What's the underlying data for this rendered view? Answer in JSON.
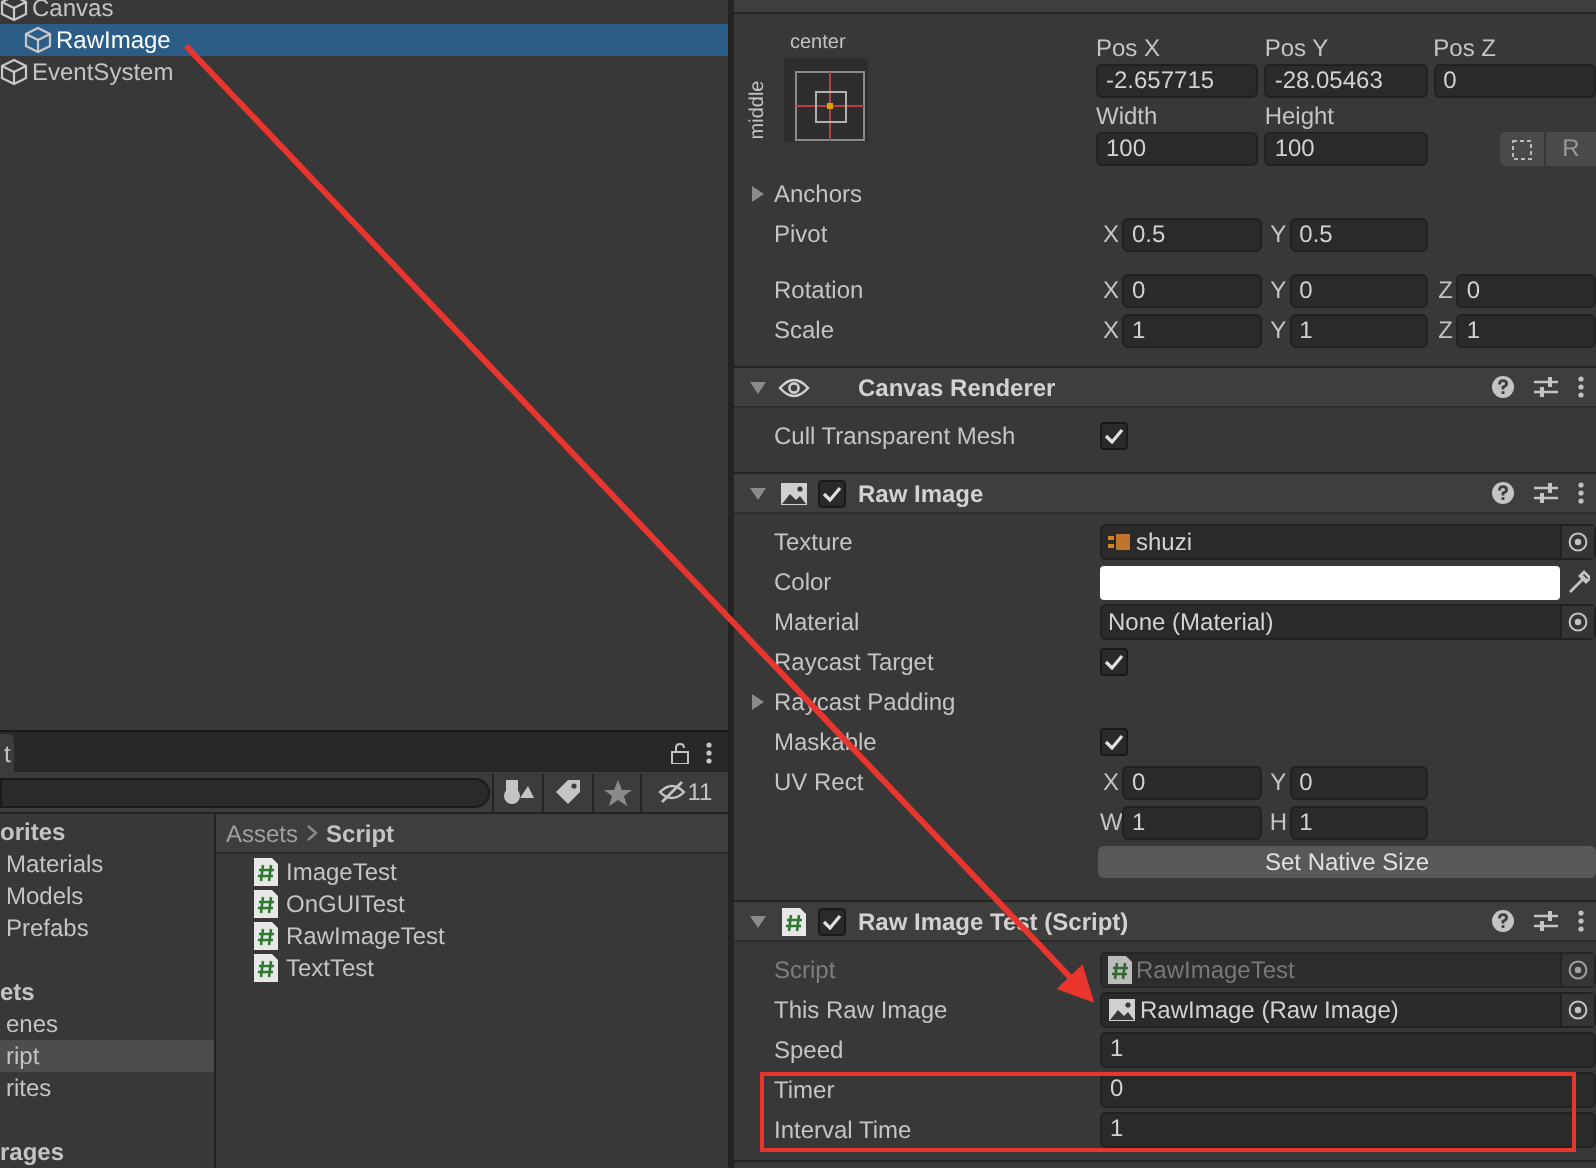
{
  "hierarchy": {
    "items": [
      {
        "label": "Canvas",
        "selected": false,
        "children": [
          {
            "label": "RawImage",
            "selected": true
          }
        ]
      },
      {
        "label": "EventSystem",
        "selected": false
      }
    ]
  },
  "project": {
    "tab": "t",
    "hidden_count": "11",
    "folders": [
      {
        "label": "orites",
        "children": [
          {
            "label": "Materials",
            "selected": false
          },
          {
            "label": "Models",
            "selected": false
          },
          {
            "label": "Prefabs",
            "selected": false
          }
        ]
      },
      {
        "label": "ets",
        "children": [
          {
            "label": "enes",
            "selected": false
          },
          {
            "label": "ript",
            "selected": true
          },
          {
            "label": "rites",
            "selected": false
          }
        ]
      },
      {
        "label": "rages"
      }
    ],
    "breadcrumb": [
      "Assets",
      "Script"
    ],
    "files": [
      "ImageTest",
      "OnGUITest",
      "RawImageTest",
      "TextTest"
    ]
  },
  "inspector": {
    "rect_transform": {
      "anchor_horizontal": "center",
      "anchor_vertical": "middle",
      "position": [
        {
          "label": "Pos X",
          "value": "-2.657715"
        },
        {
          "label": "Pos Y",
          "value": "-28.05463"
        },
        {
          "label": "Pos Z",
          "value": "0"
        }
      ],
      "size": [
        {
          "label": "Width",
          "value": "100"
        },
        {
          "label": "Height",
          "value": "100"
        }
      ],
      "raw_edit_button": "R",
      "rows": [
        {
          "kind": "foldout",
          "label": "Anchors"
        },
        {
          "kind": "vector",
          "label": "Pivot",
          "fields": [
            {
              "axis": "X",
              "value": "0.5"
            },
            {
              "axis": "Y",
              "value": "0.5"
            }
          ]
        },
        {
          "kind": "vector",
          "label": "Rotation",
          "fields": [
            {
              "axis": "X",
              "value": "0"
            },
            {
              "axis": "Y",
              "value": "0"
            },
            {
              "axis": "Z",
              "value": "0"
            }
          ]
        },
        {
          "kind": "vector",
          "label": "Scale",
          "fields": [
            {
              "axis": "X",
              "value": "1"
            },
            {
              "axis": "Y",
              "value": "1"
            },
            {
              "axis": "Z",
              "value": "1"
            }
          ]
        }
      ]
    },
    "components": [
      {
        "title": "Canvas Renderer",
        "kind": "eye",
        "expanded": true,
        "rows": [
          {
            "kind": "check",
            "label": "Cull Transparent Mesh",
            "checked": true
          }
        ]
      },
      {
        "title": "Raw Image",
        "kind": "image",
        "enabled": true,
        "expanded": true,
        "rows": [
          {
            "kind": "texture_object",
            "label": "Texture",
            "value": "shuzi",
            "disabled": false
          },
          {
            "kind": "color",
            "label": "Color",
            "color": "#ffffff"
          },
          {
            "kind": "object",
            "label": "Material",
            "value": "None (Material)",
            "disabled": false
          },
          {
            "kind": "check",
            "label": "Raycast Target",
            "checked": true
          },
          {
            "kind": "foldout",
            "label": "Raycast Padding"
          },
          {
            "kind": "check",
            "label": "Maskable",
            "checked": true
          },
          {
            "kind": "vector",
            "label": "UV Rect",
            "fields": [
              {
                "axis": "X",
                "value": "0"
              },
              {
                "axis": "Y",
                "value": "0"
              }
            ]
          },
          {
            "kind": "vector",
            "fields": [
              {
                "axis": "W",
                "value": "1"
              },
              {
                "axis": "H",
                "value": "1"
              }
            ]
          },
          {
            "kind": "button",
            "label": "Set Native Size"
          }
        ]
      },
      {
        "title": "Raw Image Test (Script)",
        "kind": "script",
        "enabled": true,
        "expanded": true,
        "rows": [
          {
            "kind": "script_object",
            "label": "Script",
            "value": "RawImageTest",
            "disabled": true
          },
          {
            "kind": "image_object",
            "label": "This Raw Image",
            "value": "RawImage (Raw Image)",
            "disabled": false
          },
          {
            "kind": "number",
            "label": "Speed",
            "value": "1"
          },
          {
            "kind": "number",
            "label": "Timer",
            "value": "0"
          },
          {
            "kind": "number",
            "label": "Interval Time",
            "value": "1"
          }
        ]
      }
    ]
  }
}
